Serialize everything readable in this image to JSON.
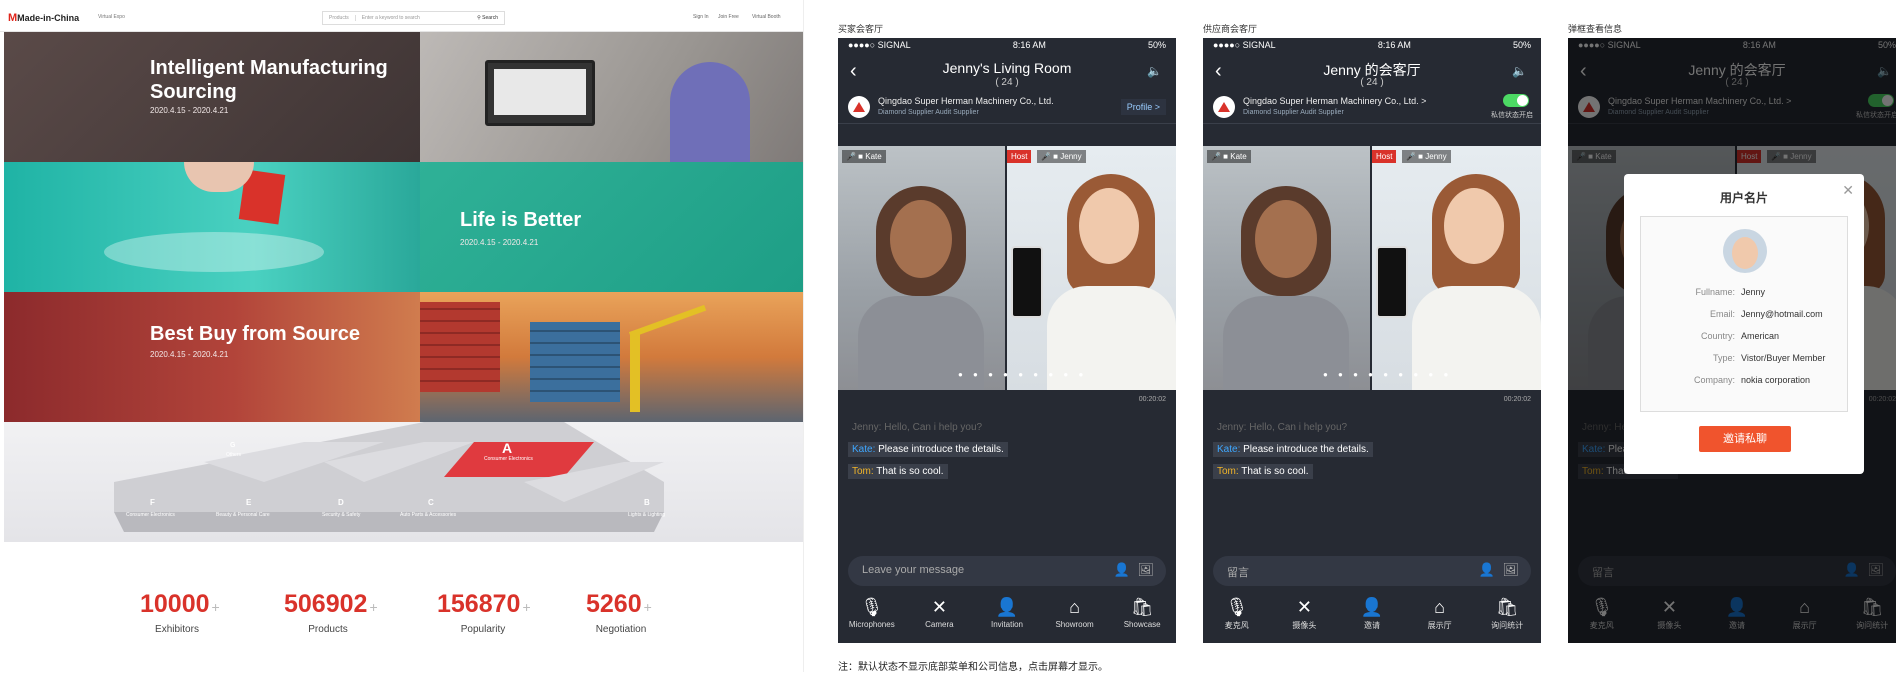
{
  "left_page": {
    "logo": "Made-in-China",
    "logo_sub": "Virtual Expo",
    "search_cat": "Products",
    "search_placeholder": "Enter a keyword to search",
    "search_btn": "Search",
    "nav_links": [
      "Sign In",
      "Join Free",
      "Virtual Booth"
    ],
    "tiles": [
      {
        "title": "Intelligent Manufacturing Sourcing",
        "date": "2020.4.15 - 2020.4.21"
      },
      {
        "title": "Life is Better",
        "date": "2020.4.15 - 2020.4.21"
      },
      {
        "title": "Best Buy from Source",
        "date": "2020.4.15 - 2020.4.21"
      }
    ],
    "map_labels": [
      {
        "letter": "A",
        "name": "Consumer Electronics"
      },
      {
        "letter": "B",
        "name": "Lights & Lighting"
      },
      {
        "letter": "C",
        "name": "Auto Parts & Accessories"
      },
      {
        "letter": "D",
        "name": "Security & Safety"
      },
      {
        "letter": "E",
        "name": "Beauty & Personal Care"
      },
      {
        "letter": "F",
        "name": "Consumer Electronics"
      },
      {
        "letter": "G",
        "name": "Others"
      }
    ],
    "stats": [
      {
        "value": "10000",
        "label": "Exhibitors"
      },
      {
        "value": "506902",
        "label": "Products"
      },
      {
        "value": "156870",
        "label": "Popularity"
      },
      {
        "value": "5260",
        "label": "Negotiation"
      }
    ],
    "plus": "+"
  },
  "phones": [
    {
      "section": "买家会客厅",
      "title": "Jenny's Living Room",
      "count": "( 24 )",
      "company": "Qingdao Super Herman Machinery Co., Ltd.",
      "badges": "Diamond Supplier   Audit Supplier",
      "right_action": "Profile >",
      "msg_placeholder": "Leave your message",
      "toolbar": [
        "Microphones",
        "Camera",
        "Invitation",
        "Showroom",
        "Showcase"
      ]
    },
    {
      "section": "供应商会客厅",
      "title": "Jenny 的会客厅",
      "count": "( 24 )",
      "company": "Qingdao Super Herman Machinery Co., Ltd. >",
      "badges": "Diamond Supplier   Audit Supplier",
      "right_action": "私信状态开启",
      "msg_placeholder": "留言",
      "toolbar": [
        "麦克风",
        "摄像头",
        "邀请",
        "展示厅",
        "询问统计"
      ]
    },
    {
      "section": "弹框查看信息",
      "title": "Jenny 的会客厅",
      "count": "( 24 )",
      "company": "Qingdao Super Herman Machinery Co., Ltd. >",
      "badges": "Diamond Supplier   Audit Supplier",
      "right_action": "私信状态开启",
      "msg_placeholder": "留言",
      "toolbar": [
        "麦克风",
        "摄像头",
        "邀请",
        "展示厅",
        "询问统计"
      ]
    }
  ],
  "status": {
    "carrier": "●●●●○ SIGNAL",
    "time": "8:16 AM",
    "battery": "50%"
  },
  "video": {
    "user_left": "Kate",
    "host": "Host",
    "user_right": "Jenny",
    "timer": "00:20:02"
  },
  "chat": [
    {
      "who": "Jenny:",
      "text": "Hello, Can i help you?"
    },
    {
      "who": "Kate:",
      "text": "Please introduce the details."
    },
    {
      "who": "Tom:",
      "text": "That is so cool."
    }
  ],
  "modal": {
    "title": "用户名片",
    "rows": [
      {
        "k": "Fullname:",
        "v": "Jenny"
      },
      {
        "k": "Email:",
        "v": "Jenny@hotmail.com"
      },
      {
        "k": "Country:",
        "v": "American"
      },
      {
        "k": "Type:",
        "v": "Vistor/Buyer Member"
      },
      {
        "k": "Company:",
        "v": "nokia corporation"
      }
    ],
    "button": "邀请私聊"
  },
  "note": "注：默认状态不显示底部菜单和公司信息，点击屏幕才显示。"
}
